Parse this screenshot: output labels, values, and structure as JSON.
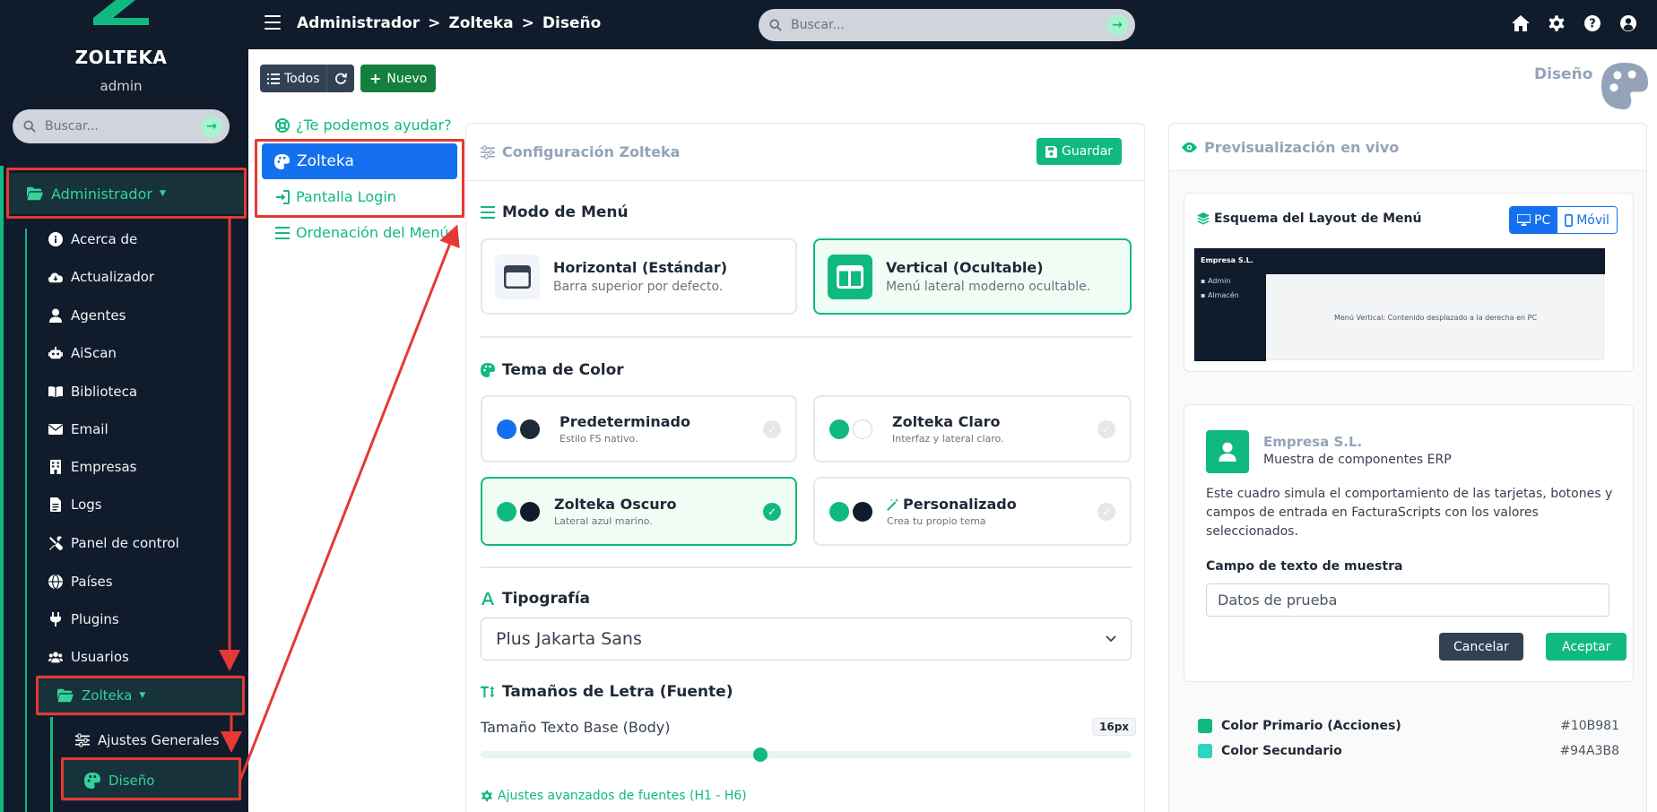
{
  "sidebar": {
    "brand": "ZOLTEKA",
    "user": "admin",
    "search_placeholder": "Buscar...",
    "group_label": "Administrador",
    "items": [
      {
        "label": "Acerca de",
        "icon": "info-circle-icon"
      },
      {
        "label": "Actualizador",
        "icon": "cloud-download-icon"
      },
      {
        "label": "Agentes",
        "icon": "user-tie-icon"
      },
      {
        "label": "AiScan",
        "icon": "robot-icon"
      },
      {
        "label": "Biblioteca",
        "icon": "book-open-icon"
      },
      {
        "label": "Email",
        "icon": "envelope-icon"
      },
      {
        "label": "Empresas",
        "icon": "building-icon"
      },
      {
        "label": "Logs",
        "icon": "file-lines-icon"
      },
      {
        "label": "Panel de control",
        "icon": "tools-icon"
      },
      {
        "label": "Países",
        "icon": "globe-icon"
      },
      {
        "label": "Plugins",
        "icon": "plug-icon"
      },
      {
        "label": "Usuarios",
        "icon": "users-icon"
      }
    ],
    "subgroup_label": "Zolteka",
    "subitems": [
      {
        "label": "Ajustes Generales",
        "icon": "sliders-icon"
      },
      {
        "label": "Diseño",
        "icon": "palette-icon"
      }
    ]
  },
  "topbar": {
    "breadcrumb": [
      "Administrador",
      ">",
      "Zolteka",
      ">",
      "Diseño"
    ],
    "search_placeholder": "Buscar..."
  },
  "toolbar": {
    "all_label": "Todos",
    "new_label": "Nuevo"
  },
  "page": {
    "title": "Diseño"
  },
  "submenu": {
    "help": "¿Te podemos ayudar?",
    "active": "Zolteka",
    "login": "Pantalla Login",
    "order": "Ordenación del Menú"
  },
  "config": {
    "title": "Configuración Zolteka",
    "save_label": "Guardar",
    "menu_mode": {
      "title": "Modo de Menú",
      "options": [
        {
          "title": "Horizontal (Estándar)",
          "desc": "Barra superior por defecto.",
          "selected": false
        },
        {
          "title": "Vertical (Ocultable)",
          "desc": "Menú lateral moderno ocultable.",
          "selected": true
        }
      ]
    },
    "theme": {
      "title": "Tema de Color",
      "options": [
        {
          "title": "Predeterminado",
          "desc": "Estilo FS nativo.",
          "colors": [
            "#1570ef",
            "#1f2937"
          ],
          "selected": false
        },
        {
          "title": "Zolteka Claro",
          "desc": "Interfaz y lateral claro.",
          "colors": [
            "#10b981",
            "#ffffff"
          ],
          "selected": false
        },
        {
          "title": "Zolteka Oscuro",
          "desc": "Lateral azul marino.",
          "colors": [
            "#10b981",
            "#101b2b"
          ],
          "selected": true
        },
        {
          "title": "Personalizado",
          "desc": "Crea tu propio tema",
          "colors": [
            "#10b981",
            "#101b2b"
          ],
          "selected": false
        }
      ]
    },
    "typography": {
      "title": "Tipografía",
      "selected": "Plus Jakarta Sans"
    },
    "sizes": {
      "title": "Tamaños de Letra (Fuente)",
      "base_label": "Tamaño Texto Base (Body)",
      "base_value": "16px",
      "slider_fraction": 0.43
    },
    "advanced_link": "Ajustes avanzados de fuentes (H1 - H6)"
  },
  "preview": {
    "title": "Previsualización en vivo",
    "layout": {
      "title": "Esquema del Layout de Menú",
      "toggle_pc": "PC",
      "toggle_mobile": "Móvil",
      "mini_brand": "Empresa S.L.",
      "mini_items": [
        "Admin",
        "Almacén"
      ],
      "mini_caption": "Menú Vertical: Contenido desplazado a la derecha en PC"
    },
    "company": {
      "name": "Empresa S.L.",
      "subtitle": "Muestra de componentes ERP",
      "description": "Este cuadro simula el comportamiento de las tarjetas, botones y campos de entrada en FacturaScripts con los valores seleccionados.",
      "field_label": "Campo de texto de muestra",
      "field_value": "Datos de prueba",
      "cancel_label": "Cancelar",
      "ok_label": "Aceptar"
    },
    "colors": [
      {
        "label": "Color Primario (Acciones)",
        "hex": "#10B981",
        "swatch": "#10B981"
      },
      {
        "label": "Color Secundario",
        "hex": "#94A3B8",
        "swatch": "#2dd4bf"
      }
    ]
  }
}
